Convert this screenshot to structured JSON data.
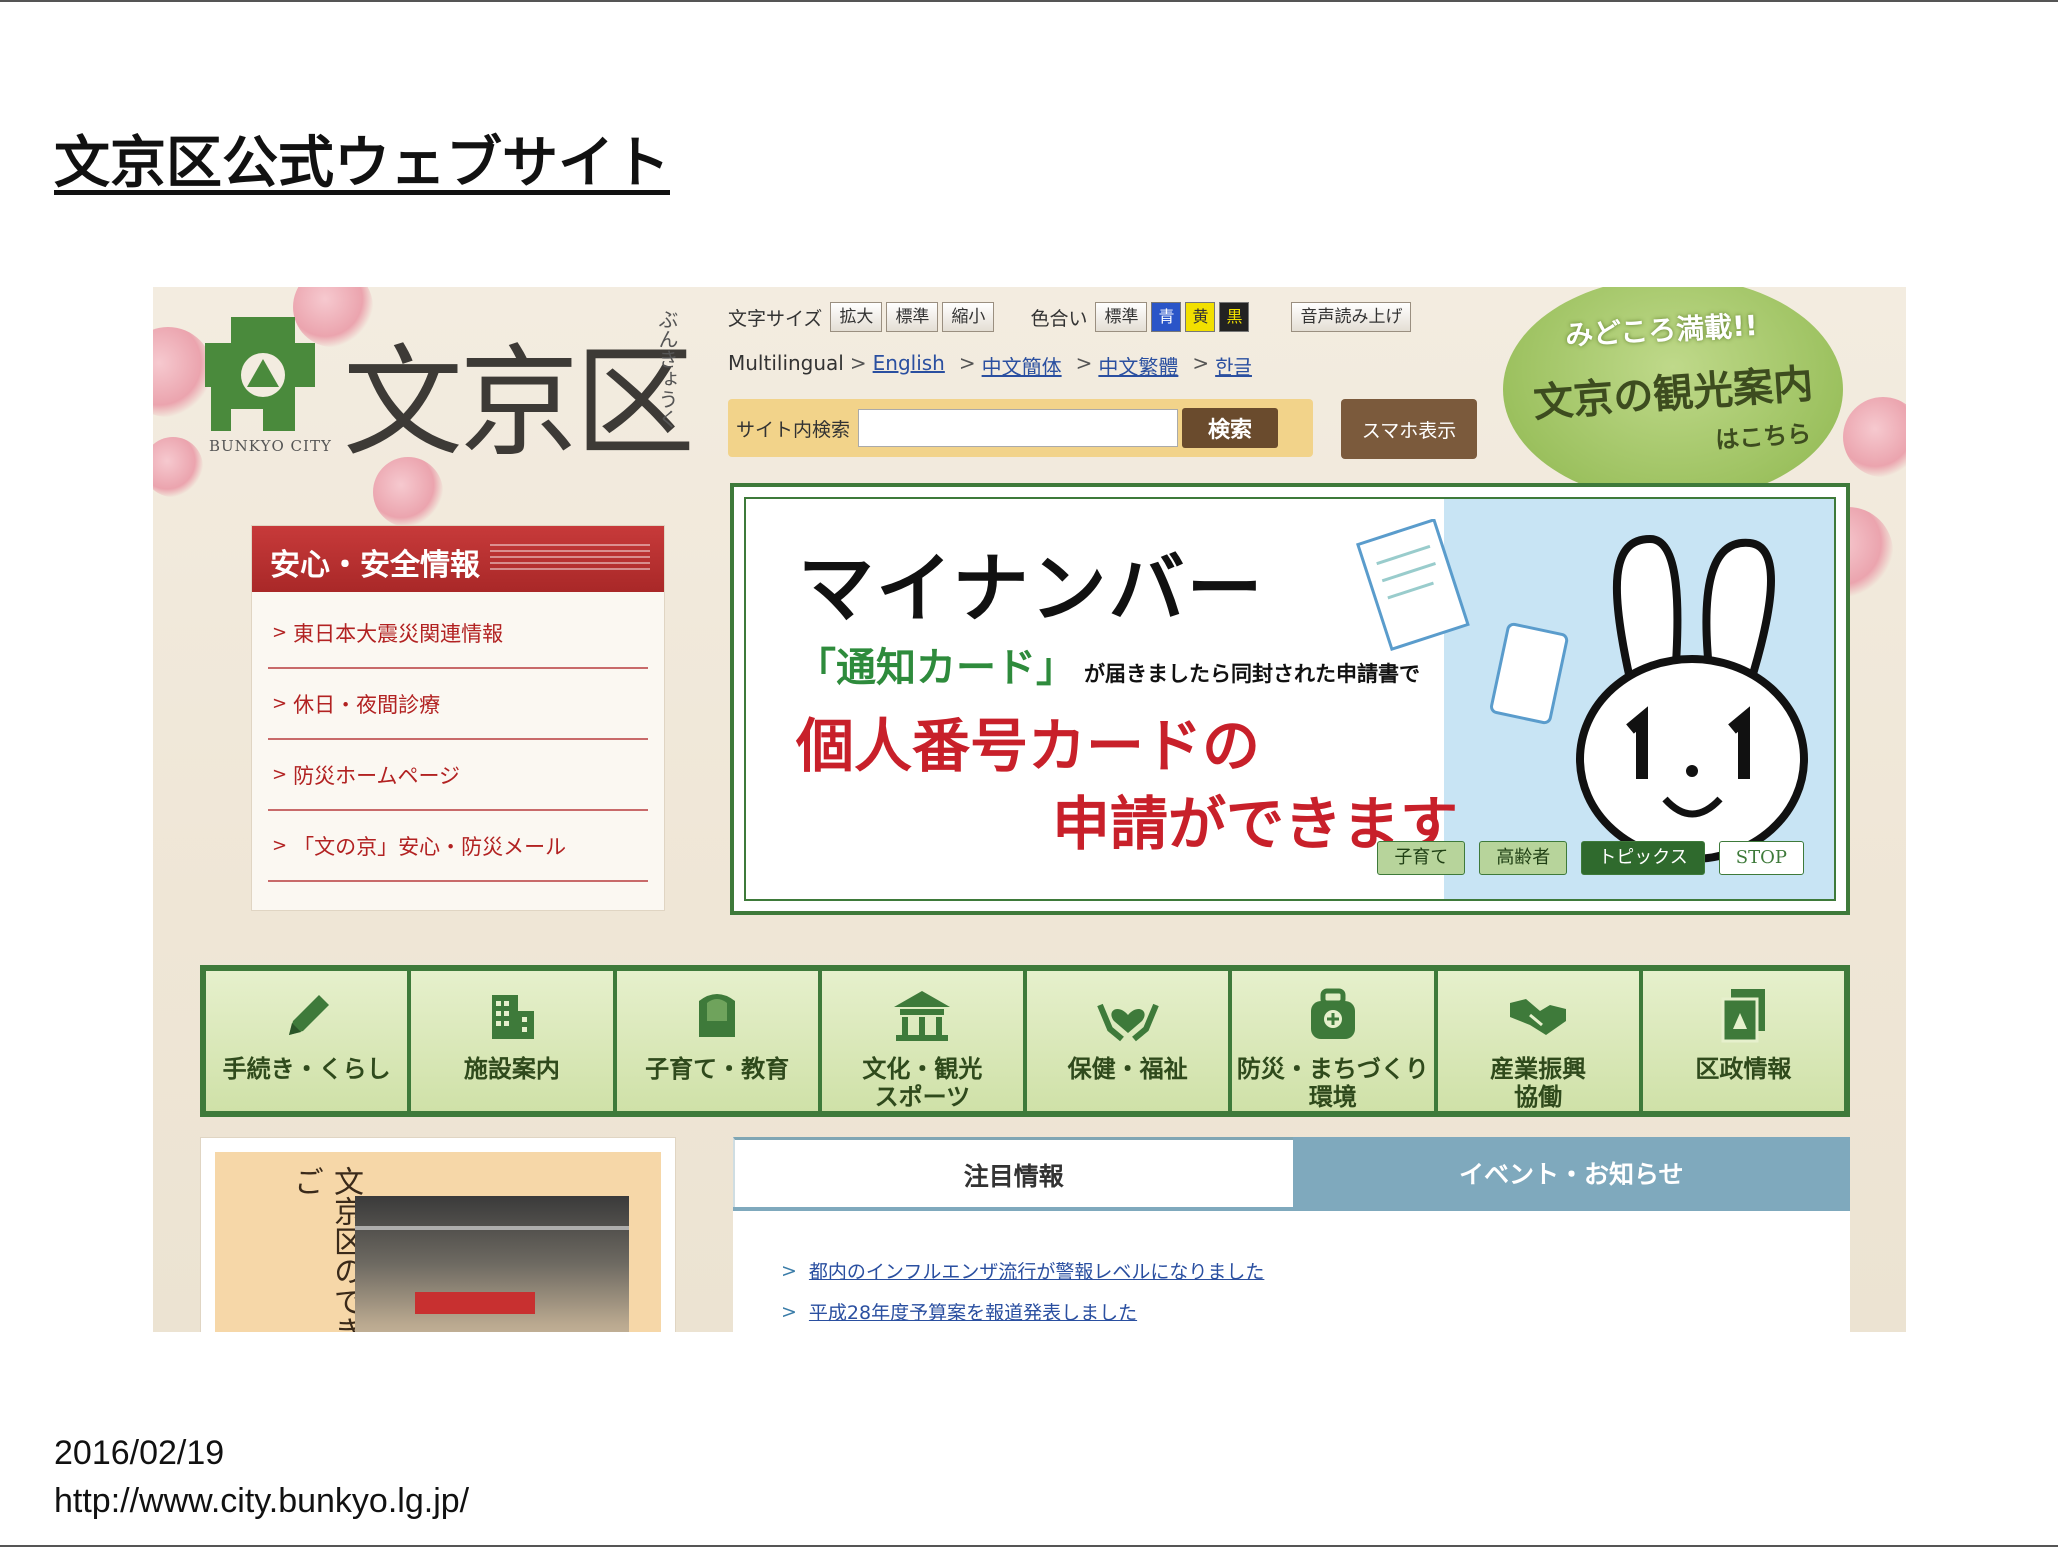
{
  "slide": {
    "title": "文京区公式ウェブサイト",
    "date": "2016/02/19",
    "url": "http://www.city.bunkyo.lg.jp/"
  },
  "site": {
    "logo_text": "文京区",
    "logo_sub": "BUNKYO CITY",
    "logo_kana": "ぶんきょうく",
    "font_size": {
      "label": "文字サイズ",
      "buttons": [
        "拡大",
        "標準",
        "縮小"
      ]
    },
    "color_scheme": {
      "label": "色合い",
      "standard": "標準",
      "options": [
        {
          "label": "青",
          "color": "#2a55c8",
          "text_color": "#ffffff"
        },
        {
          "label": "黄",
          "color": "#f2e000",
          "text_color": "#333333"
        },
        {
          "label": "黒",
          "color": "#222222",
          "text_color": "#f2e000"
        }
      ]
    },
    "voice_button": "音声読み上げ",
    "multilingual": {
      "label": "Multilingual",
      "links": [
        "English",
        "中文簡体",
        "中文繁體",
        "한글"
      ]
    },
    "search": {
      "label": "サイト内検索",
      "placeholder": "",
      "button": "検索"
    },
    "smartphone_button": "スマホ表示",
    "sightseeing": {
      "line1": "みどころ満載!!",
      "line2": "文京の観光案内",
      "line3": "はこちら"
    },
    "safety": {
      "title": "安心・安全情報",
      "items": [
        "東日本大震災関連情報",
        "休日・夜間診療",
        "防災ホームページ",
        "「文の京」安心・防災メール"
      ]
    },
    "banner": {
      "title": "マイナンバー",
      "card": "「通知カード」",
      "card_rest": "が届きましたら同封された申請書で",
      "big1": "個人番号カードの",
      "big2": "申請ができます",
      "tags": [
        "子育て",
        "高齢者",
        "トピックス",
        "STOP"
      ]
    },
    "categories": [
      {
        "label": "手続き・くらし",
        "icon": "pencil-icon"
      },
      {
        "label": "施設案内",
        "icon": "building-icon"
      },
      {
        "label": "子育て・教育",
        "icon": "school-bag-icon"
      },
      {
        "label": "文化・観光\nスポーツ",
        "icon": "temple-icon"
      },
      {
        "label": "保健・福祉",
        "icon": "heart-hands-icon"
      },
      {
        "label": "防災・まちづくり\n環境",
        "icon": "emergency-bag-icon"
      },
      {
        "label": "産業振興\n協働",
        "icon": "handshake-icon"
      },
      {
        "label": "区政情報",
        "icon": "document-icon"
      }
    ],
    "feature_text": "文京区のできご",
    "tabs": [
      "注目情報",
      "イベント・お知らせ"
    ],
    "news": [
      "都内のインフルエンザ流行が警報レベルになりました",
      "平成28年度予算案を報道発表しました"
    ]
  }
}
